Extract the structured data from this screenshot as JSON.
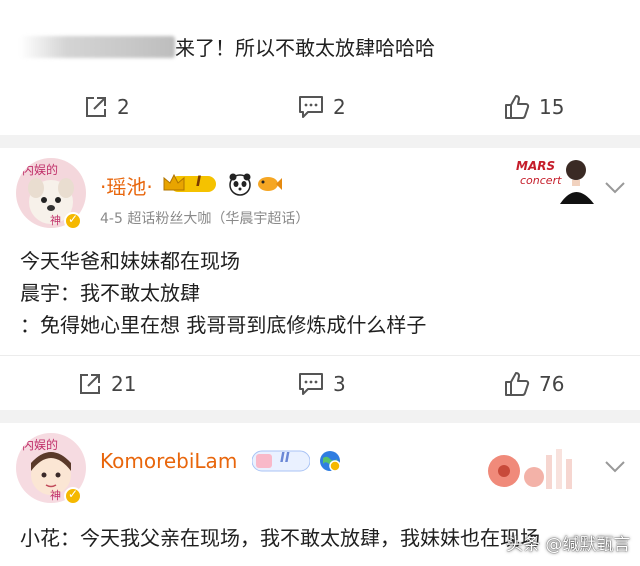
{
  "post1": {
    "text_visible": "来了！所以不敢太放肆哈哈哈",
    "actions": {
      "repost": "2",
      "comment": "2",
      "like": "15"
    }
  },
  "comment1": {
    "username": "·瑶池·",
    "level_badge": "I",
    "meta": "4-5  超话粉丝大咖（华晨宇超话）",
    "lines": [
      "今天华爸和妹妹都在现场",
      "晨宇：我不敢太放肆",
      "：免得她心里在想 我哥哥到底修炼成什么样子"
    ],
    "actions": {
      "repost": "21",
      "comment": "3",
      "like": "76"
    }
  },
  "comment2": {
    "username": "KomorebiLam",
    "level_badge": "II",
    "text": "小花：今天我父亲在现场，我不敢太放肆，我妹妹也在现场"
  },
  "watermark": "头条 @缄默甄言",
  "colors": {
    "accent": "#e8660c",
    "separator": "#f2f2f2",
    "meta": "#8a8a8a"
  }
}
